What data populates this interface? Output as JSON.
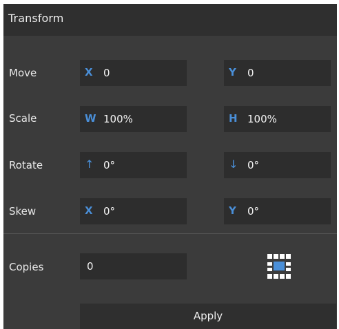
{
  "panel": {
    "title": "Transform"
  },
  "move": {
    "label": "Move",
    "x_axis": "X",
    "x_value": "0",
    "y_axis": "Y",
    "y_value": "0"
  },
  "scale": {
    "label": "Scale",
    "w_axis": "W",
    "w_value": "100%",
    "h_axis": "H",
    "h_value": "100%"
  },
  "rotate": {
    "label": "Rotate",
    "cw_axis": "↑",
    "cw_value": "0°",
    "ccw_axis": "↓",
    "ccw_value": "0°"
  },
  "skew": {
    "label": "Skew",
    "x_axis": "X",
    "x_value": "0°",
    "y_axis": "Y",
    "y_value": "0°"
  },
  "copies": {
    "label": "Copies",
    "value": "0"
  },
  "anchor": {
    "icon": "anchor-grid-icon",
    "selected": "center"
  },
  "apply": {
    "label": "Apply"
  },
  "colors": {
    "accent": "#4a8fd8",
    "panel_bg": "#3b3b3b",
    "header_bg": "#2f2f2f",
    "field_bg": "#2d2d2d"
  }
}
